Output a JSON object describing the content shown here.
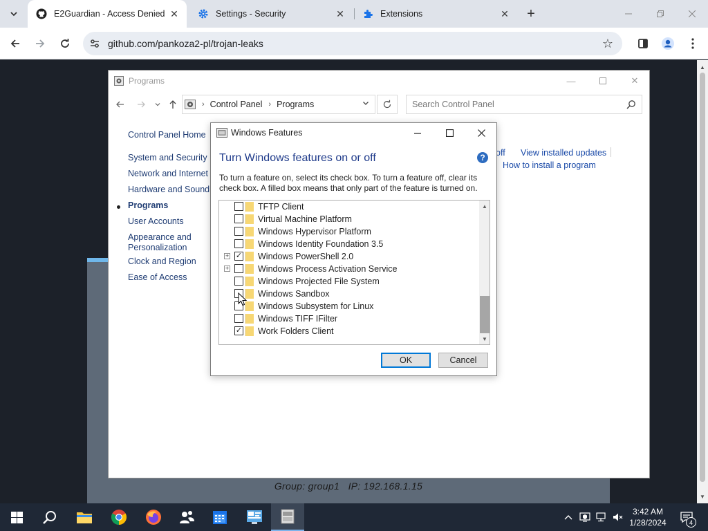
{
  "browser": {
    "tabs": [
      {
        "label": "E2Guardian - Access Denied",
        "icon": "github-icon",
        "active": true
      },
      {
        "label": "Settings - Security",
        "icon": "gear-icon",
        "active": false
      },
      {
        "label": "Extensions",
        "icon": "puzzle-icon",
        "active": false
      }
    ],
    "url": "github.com/pankoza2-pl/trojan-leaks"
  },
  "programs_window": {
    "title": "Programs",
    "breadcrumb": [
      "Control Panel",
      "Programs"
    ],
    "search_placeholder": "Search Control Panel",
    "left_nav": [
      "Control Panel Home",
      "System and Security",
      "Network and Internet",
      "Hardware and Sound",
      "Programs",
      "User Accounts",
      "Appearance and Personalization",
      "Clock and Region",
      "Ease of Access"
    ],
    "right_links": {
      "turn_off_partial": "off",
      "view_updates": "View installed updates",
      "how_to_install": "How to install a program"
    }
  },
  "features_dialog": {
    "title": "Windows Features",
    "heading": "Turn Windows features on or off",
    "help": "?",
    "description": "To turn a feature on, select its check box. To turn a feature off, clear its check box. A filled box means that only part of the feature is turned on.",
    "features": [
      {
        "label": "TFTP Client",
        "checked": false,
        "expandable": false
      },
      {
        "label": "Virtual Machine Platform",
        "checked": false,
        "expandable": false
      },
      {
        "label": "Windows Hypervisor Platform",
        "checked": false,
        "expandable": false
      },
      {
        "label": "Windows Identity Foundation 3.5",
        "checked": false,
        "expandable": false
      },
      {
        "label": "Windows PowerShell 2.0",
        "checked": true,
        "expandable": true
      },
      {
        "label": "Windows Process Activation Service",
        "checked": false,
        "expandable": true
      },
      {
        "label": "Windows Projected File System",
        "checked": false,
        "expandable": false
      },
      {
        "label": "Windows Sandbox",
        "checked": false,
        "expandable": false
      },
      {
        "label": "Windows Subsystem for Linux",
        "checked": false,
        "expandable": false
      },
      {
        "label": "Windows TIFF IFilter",
        "checked": false,
        "expandable": false
      },
      {
        "label": "Work Folders Client",
        "checked": true,
        "expandable": false
      }
    ],
    "ok_label": "OK",
    "cancel_label": "Cancel"
  },
  "remote_overlay": {
    "group_info": "Group: group1   IP: 192.168.1.15"
  },
  "taskbar": {
    "time": "3:42 AM",
    "date": "1/28/2024",
    "notification_count": "4"
  },
  "colors": {
    "accent": "#0078d7",
    "heading_blue": "#1e3a8a",
    "link_blue": "#1a4aa8",
    "taskbar_bg": "#1f2836"
  }
}
